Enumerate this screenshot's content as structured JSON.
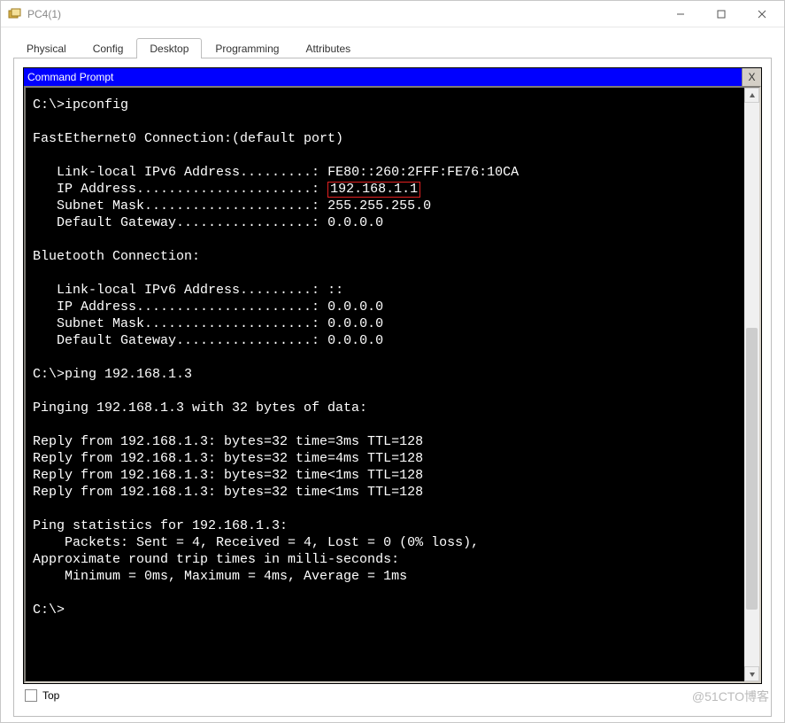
{
  "window": {
    "title": "PC4(1)"
  },
  "tabs": {
    "items": [
      {
        "label": "Physical"
      },
      {
        "label": "Config"
      },
      {
        "label": "Desktop"
      },
      {
        "label": "Programming"
      },
      {
        "label": "Attributes"
      }
    ],
    "active_index": 2
  },
  "panel": {
    "title": "Command Prompt",
    "close_label": "X"
  },
  "terminal": {
    "prompt1": "C:\\>ipconfig",
    "sec1_title": "FastEthernet0 Connection:(default port)",
    "sec1_ipv6_label": "   Link-local IPv6 Address.........: ",
    "sec1_ipv6_value": "FE80::260:2FFF:FE76:10CA",
    "sec1_ip_label": "   IP Address......................: ",
    "sec1_ip_value": "192.168.1.1",
    "sec1_mask_label": "   Subnet Mask.....................: ",
    "sec1_mask_value": "255.255.255.0",
    "sec1_gw_label": "   Default Gateway.................: ",
    "sec1_gw_value": "0.0.0.0",
    "sec2_title": "Bluetooth Connection:",
    "sec2_ipv6_label": "   Link-local IPv6 Address.........: ",
    "sec2_ipv6_value": "::",
    "sec2_ip_label": "   IP Address......................: ",
    "sec2_ip_value": "0.0.0.0",
    "sec2_mask_label": "   Subnet Mask.....................: ",
    "sec2_mask_value": "0.0.0.0",
    "sec2_gw_label": "   Default Gateway.................: ",
    "sec2_gw_value": "0.0.0.0",
    "prompt2": "C:\\>ping 192.168.1.3",
    "ping_header": "Pinging 192.168.1.3 with 32 bytes of data:",
    "reply1": "Reply from 192.168.1.3: bytes=32 time=3ms TTL=128",
    "reply2": "Reply from 192.168.1.3: bytes=32 time=4ms TTL=128",
    "reply3": "Reply from 192.168.1.3: bytes=32 time<1ms TTL=128",
    "reply4": "Reply from 192.168.1.3: bytes=32 time<1ms TTL=128",
    "stats_header": "Ping statistics for 192.168.1.3:",
    "stats_packets": "    Packets: Sent = 4, Received = 4, Lost = 0 (0% loss),",
    "stats_rtt_header": "Approximate round trip times in milli-seconds:",
    "stats_rtt": "    Minimum = 0ms, Maximum = 4ms, Average = 1ms",
    "prompt3": "C:\\>"
  },
  "bottom": {
    "top_label": "Top"
  },
  "watermark": "@51CTO博客"
}
